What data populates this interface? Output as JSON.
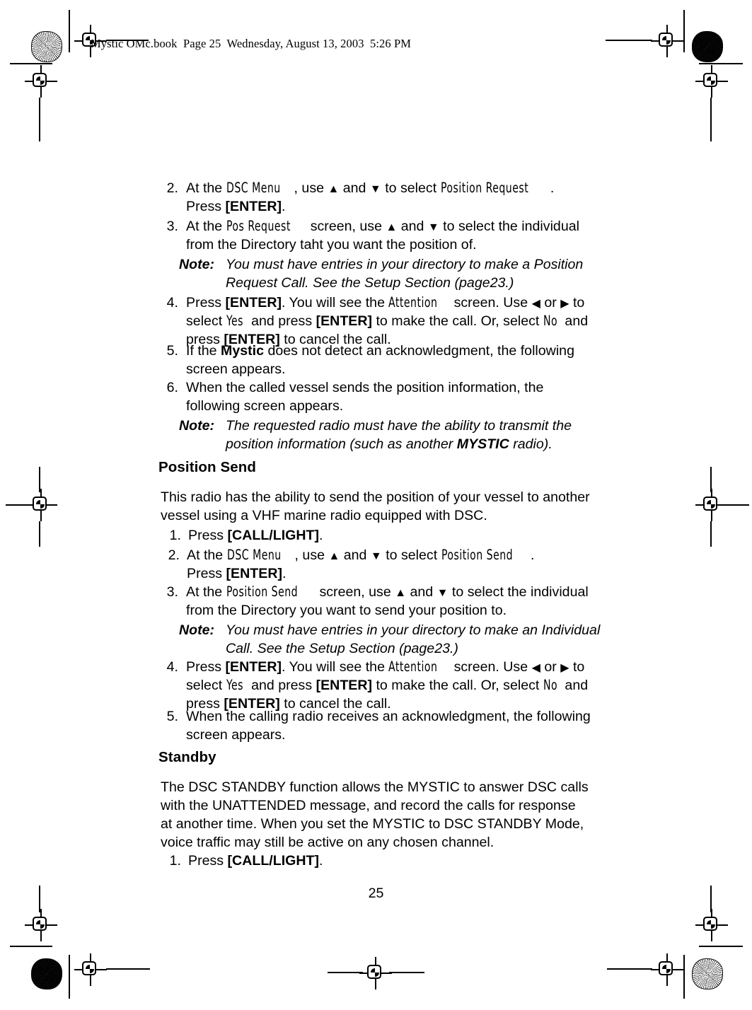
{
  "document": {
    "slug": "Mystic OMc.book  Page 25  Wednesday, August 13, 2003  5:26 PM",
    "page_number": "25"
  },
  "sections": {
    "position_request_continued": {
      "steps": [
        {
          "number": "2.",
          "line1_a": "At the ",
          "line1_lcd1": "DSC Menu",
          "line1_b": ", use ",
          "line1_up": "▲",
          "line1_c": " and ",
          "line1_down": "▼",
          "line1_d": " to select ",
          "line1_lcd2": "Position Request",
          "line1_e": ".",
          "line2_a": "Press ",
          "line2_bold": "[ENTER]",
          "line2_b": "."
        },
        {
          "number": "3.",
          "line1_a": "At the ",
          "line1_lcd1": "Pos Request",
          "line1_b": " screen, use ",
          "line1_up": "▲",
          "line1_c": " and ",
          "line1_down": "▼",
          "line1_d": " to select the individual",
          "line2": "from the Directory taht you want the position of."
        }
      ],
      "note1": {
        "label": "Note:",
        "line1": "You must have entries in your directory to make a Position",
        "line2": "Request Call. See the Setup Section (page23.)"
      },
      "step4": {
        "number": "4.",
        "line1_a": "Press ",
        "line1_bold": "[ENTER]",
        "line1_b": ". You will see the ",
        "line1_lcd": "Attention",
        "line1_c": " screen. Use ",
        "line1_left": "◀",
        "line1_d": " or ",
        "line1_right": "▶",
        "line1_e": " to",
        "line2_a": "select ",
        "line2_lcd1": "Yes",
        "line2_b": " and press ",
        "line2_bold1": "[ENTER]",
        "line2_c": " to make the call. Or, select ",
        "line2_lcd2": "No",
        "line2_d": " and",
        "line3_a": "press ",
        "line3_bold": "[ENTER]",
        "line3_b": " to cancel the call."
      },
      "step5": {
        "number": "5.",
        "line1_a": "If the ",
        "line1_bold": "Mystic",
        "line1_b": " does not detect an acknowledgment, the following",
        "line2": "screen appears."
      },
      "step6": {
        "number": "6.",
        "line1": "When the called vessel sends the position information, the",
        "line2": "following screen appears."
      },
      "note2": {
        "label": "Note:",
        "line1": "The requested radio must have the ability to transmit the",
        "line2_a": "position information (such as another ",
        "line2_bold": "MYSTIC",
        "line2_b": " radio)."
      }
    },
    "position_send": {
      "heading": "Position Send",
      "intro_line1": "This radio has the ability to send the position of your vessel to another",
      "intro_line2": "vessel using a VHF marine radio equipped with DSC.",
      "step1": {
        "number": "1.",
        "line1_a": "Press ",
        "line1_bold": "[CALL/LIGHT]",
        "line1_b": "."
      },
      "step2": {
        "number": "2.",
        "line1_a": "At the ",
        "line1_lcd1": "DSC Menu",
        "line1_b": ", use ",
        "line1_up": "▲",
        "line1_c": " and ",
        "line1_down": "▼",
        "line1_d": " to select ",
        "line1_lcd2": "Position Send",
        "line1_e": ".",
        "line2_a": "Press ",
        "line2_bold": "[ENTER]",
        "line2_b": "."
      },
      "step3": {
        "number": "3.",
        "line1_a": "At the ",
        "line1_lcd": "Position Send",
        "line1_b": " screen, use ",
        "line1_up": "▲",
        "line1_c": " and ",
        "line1_down": "▼",
        "line1_d": " to select the individual",
        "line2": "from the Directory you want to send your position to."
      },
      "note": {
        "label": "Note:",
        "line1": "You must have entries in your directory to make an Individual",
        "line2": "Call. See the Setup Section (page23.)"
      },
      "step4": {
        "number": "4.",
        "line1_a": "Press ",
        "line1_bold": "[ENTER]",
        "line1_b": ". You will see the ",
        "line1_lcd": "Attention",
        "line1_c": " screen. Use ",
        "line1_left": "◀",
        "line1_d": " or ",
        "line1_right": "▶",
        "line1_e": " to",
        "line2_a": "select ",
        "line2_lcd1": "Yes",
        "line2_b": " and press ",
        "line2_bold1": "[ENTER]",
        "line2_c": " to make the call. Or, select ",
        "line2_lcd2": "No",
        "line2_d": " and",
        "line3_a": "press ",
        "line3_bold": "[ENTER]",
        "line3_b": " to cancel the call."
      },
      "step5": {
        "number": "5.",
        "line1": "When the calling radio receives an acknowledgment, the following",
        "line2": "screen appears."
      }
    },
    "standby": {
      "heading": "Standby",
      "intro_line1": "The DSC STANDBY function allows the MYSTIC to answer DSC calls",
      "intro_line2": "with the UNATTENDED message, and record the calls for response",
      "intro_line3": "at another time. When you set the MYSTIC to DSC STANDBY Mode,",
      "intro_line4": "voice traffic may still be active on any chosen channel.",
      "step1": {
        "number": "1.",
        "line1_a": "Press ",
        "line1_bold": "[CALL/LIGHT]",
        "line1_b": "."
      }
    }
  }
}
